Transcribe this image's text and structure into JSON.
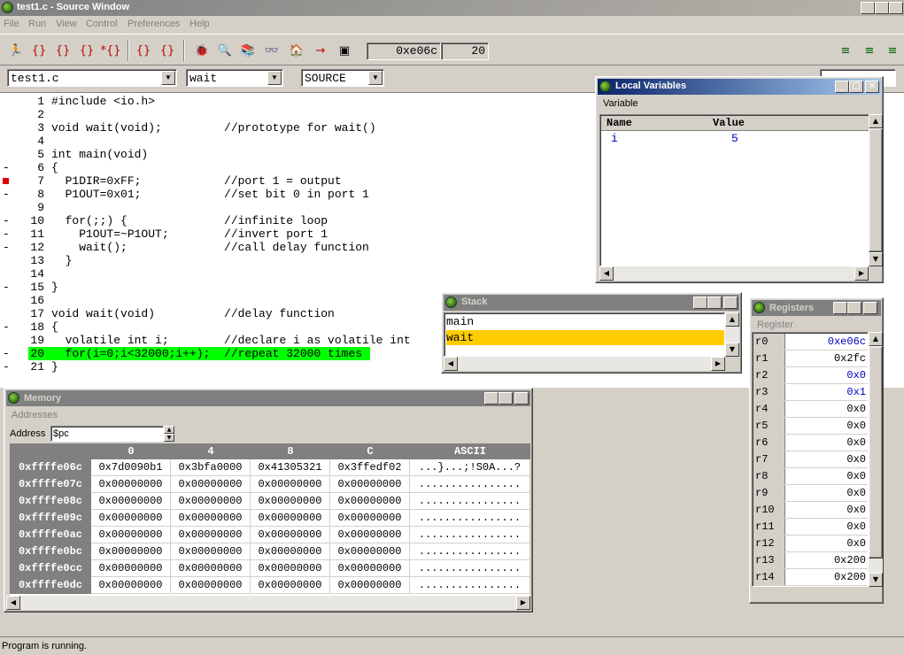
{
  "window": {
    "title": "test1.c - Source Window"
  },
  "menu": [
    "File",
    "Run",
    "View",
    "Control",
    "Preferences",
    "Help"
  ],
  "toolbar": {
    "pc": "0xe06c",
    "line": "20"
  },
  "combos": {
    "file": "test1.c",
    "function": "wait",
    "mode": "SOURCE"
  },
  "source": [
    {
      "n": "1",
      "m": "",
      "code": "#include <io.h>"
    },
    {
      "n": "2",
      "m": "",
      "code": ""
    },
    {
      "n": "3",
      "m": "",
      "code": "void wait(void);         //prototype for wait()"
    },
    {
      "n": "4",
      "m": "",
      "code": ""
    },
    {
      "n": "5",
      "m": "",
      "code": "int main(void)"
    },
    {
      "n": "6",
      "m": "-",
      "code": "{"
    },
    {
      "n": "7",
      "m": "bp",
      "code": "  P1DIR=0xFF;            //port 1 = output"
    },
    {
      "n": "8",
      "m": "-",
      "code": "  P1OUT=0x01;            //set bit 0 in port 1"
    },
    {
      "n": "9",
      "m": "",
      "code": ""
    },
    {
      "n": "10",
      "m": "-",
      "code": "  for(;;) {              //infinite loop"
    },
    {
      "n": "11",
      "m": "-",
      "code": "    P1OUT=~P1OUT;        //invert port 1"
    },
    {
      "n": "12",
      "m": "-",
      "code": "    wait();              //call delay function"
    },
    {
      "n": "13",
      "m": "",
      "code": "  }"
    },
    {
      "n": "14",
      "m": "",
      "code": ""
    },
    {
      "n": "15",
      "m": "-",
      "code": "}"
    },
    {
      "n": "16",
      "m": "",
      "code": ""
    },
    {
      "n": "17",
      "m": "",
      "code": "void wait(void)          //delay function"
    },
    {
      "n": "18",
      "m": "-",
      "code": "{"
    },
    {
      "n": "19",
      "m": "",
      "code": "  volatile int i;        //declare i as volatile int"
    },
    {
      "n": "20",
      "m": "-",
      "code": "  for(i=0;i<32000;i++);  //repeat 32000 times"
    },
    {
      "n": "21",
      "m": "-",
      "code": "}"
    }
  ],
  "locals": {
    "title": "Local Variables",
    "menu": "Variable",
    "col_name": "Name",
    "col_value": "Value",
    "rows": [
      {
        "name": "i",
        "value": "5"
      }
    ]
  },
  "stack": {
    "title": "Stack",
    "items": [
      "main",
      "wait"
    ]
  },
  "registers": {
    "title": "Registers",
    "menu": "Register",
    "rows": [
      {
        "n": "r0",
        "v": "0xe06c",
        "c": true
      },
      {
        "n": "r1",
        "v": "0x2fc",
        "c": false
      },
      {
        "n": "r2",
        "v": "0x0",
        "c": true
      },
      {
        "n": "r3",
        "v": "0x1",
        "c": true
      },
      {
        "n": "r4",
        "v": "0x0",
        "c": false
      },
      {
        "n": "r5",
        "v": "0x0",
        "c": false
      },
      {
        "n": "r6",
        "v": "0x0",
        "c": false
      },
      {
        "n": "r7",
        "v": "0x0",
        "c": false
      },
      {
        "n": "r8",
        "v": "0x0",
        "c": false
      },
      {
        "n": "r9",
        "v": "0x0",
        "c": false
      },
      {
        "n": "r10",
        "v": "0x0",
        "c": false
      },
      {
        "n": "r11",
        "v": "0x0",
        "c": false
      },
      {
        "n": "r12",
        "v": "0x0",
        "c": false
      },
      {
        "n": "r13",
        "v": "0x200",
        "c": false
      },
      {
        "n": "r14",
        "v": "0x200",
        "c": false
      }
    ]
  },
  "memory": {
    "title": "Memory",
    "menu": "Addresses",
    "address_label": "Address",
    "address_value": "$pc",
    "headers": [
      "0",
      "4",
      "8",
      "C",
      "ASCII"
    ],
    "rows": [
      {
        "a": "0xffffe06c",
        "c": [
          "0x7d0090b1",
          "0x3bfa0000",
          "0x41305321",
          "0x3ffedf02",
          "...}...;!S0A...?"
        ]
      },
      {
        "a": "0xffffe07c",
        "c": [
          "0x00000000",
          "0x00000000",
          "0x00000000",
          "0x00000000",
          "................"
        ]
      },
      {
        "a": "0xffffe08c",
        "c": [
          "0x00000000",
          "0x00000000",
          "0x00000000",
          "0x00000000",
          "................"
        ]
      },
      {
        "a": "0xffffe09c",
        "c": [
          "0x00000000",
          "0x00000000",
          "0x00000000",
          "0x00000000",
          "................"
        ]
      },
      {
        "a": "0xffffe0ac",
        "c": [
          "0x00000000",
          "0x00000000",
          "0x00000000",
          "0x00000000",
          "................"
        ]
      },
      {
        "a": "0xffffe0bc",
        "c": [
          "0x00000000",
          "0x00000000",
          "0x00000000",
          "0x00000000",
          "................"
        ]
      },
      {
        "a": "0xffffe0cc",
        "c": [
          "0x00000000",
          "0x00000000",
          "0x00000000",
          "0x00000000",
          "................"
        ]
      },
      {
        "a": "0xffffe0dc",
        "c": [
          "0x00000000",
          "0x00000000",
          "0x00000000",
          "0x00000000",
          "................"
        ]
      }
    ]
  },
  "status": "Program is running.",
  "colors": {
    "highlight": "#00ff00",
    "breakpoint": "#e00000",
    "changed": "#0000c0",
    "selection": "#ffcc00",
    "address_col": "#808080"
  }
}
